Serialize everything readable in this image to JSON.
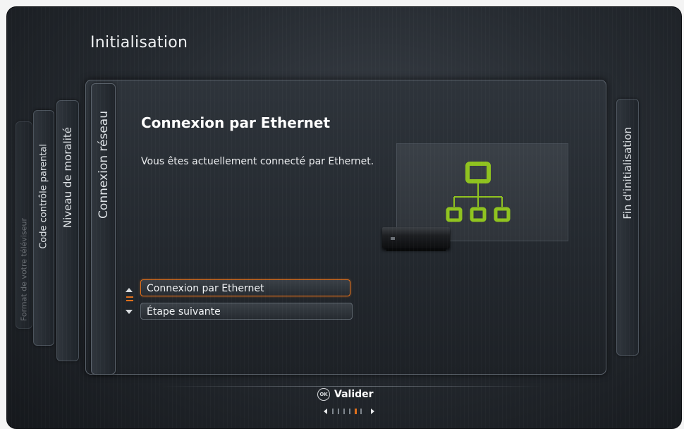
{
  "app_title": "Initialisation",
  "steps": [
    {
      "label": "Format de votre téléviseur"
    },
    {
      "label": "Code contrôle parental"
    },
    {
      "label": "Niveau de moralité"
    },
    {
      "label": "Connexion réseau"
    }
  ],
  "last_step": {
    "label": "Fin d'initialisation"
  },
  "content": {
    "heading": "Connexion par Ethernet",
    "description": "Vous êtes actuellement connecté par Ethernet."
  },
  "options": [
    {
      "label": "Connexion par Ethernet",
      "selected": true
    },
    {
      "label": "Étape suivante",
      "selected": false
    }
  ],
  "footer": {
    "ok_icon_text": "OK",
    "action_label": "Valider"
  },
  "pager": {
    "total": 6,
    "current": 5
  },
  "colors": {
    "accent": "#e0701c",
    "network_icon": "#8fc31f"
  },
  "icons": {
    "network": "network-diagram-icon",
    "set_top_box": "set-top-box-icon",
    "ok": "ok-button-icon"
  }
}
